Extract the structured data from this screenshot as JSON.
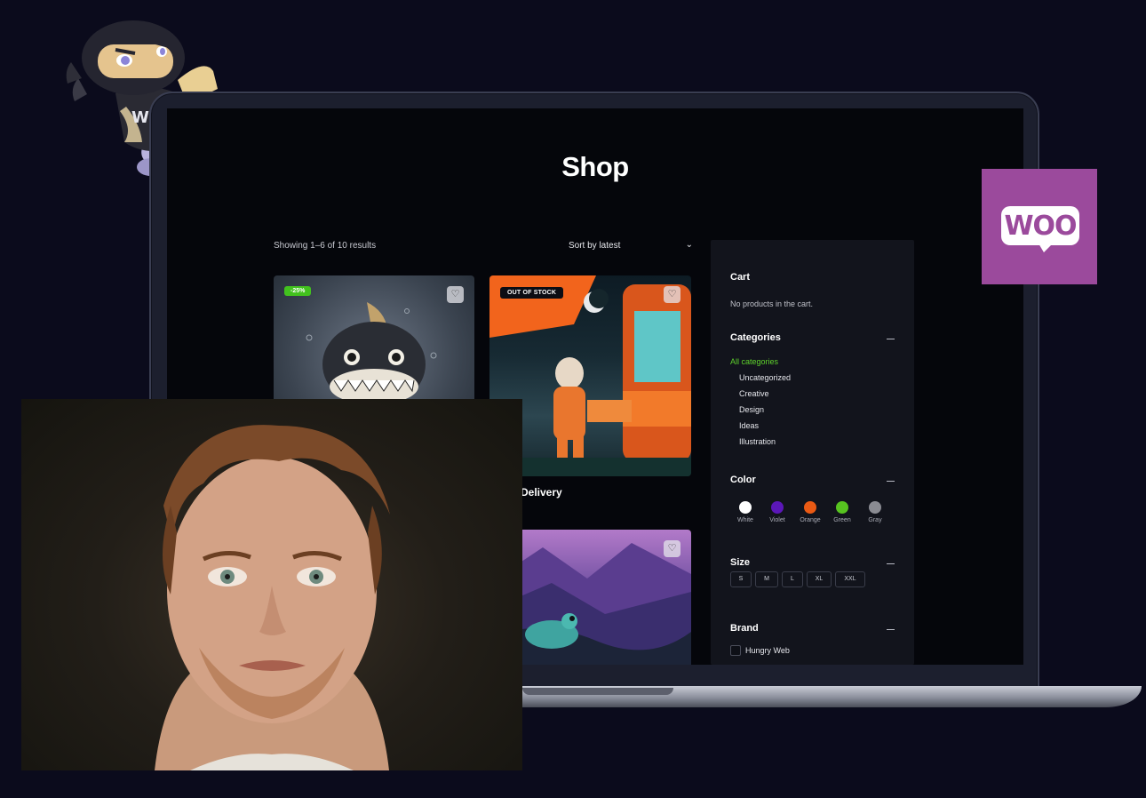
{
  "shop": {
    "title": "Shop",
    "results_text": "Showing 1–6 of 10 results",
    "sort_label": "Sort by latest"
  },
  "products": [
    {
      "badge": "-25%",
      "badge_color": "#42c21e",
      "image": "shark-cartoon-image"
    },
    {
      "badge": "OUT OF STOCK",
      "image": "astronaut-food-cart-image",
      "name_partial": "Delivery"
    },
    {
      "image": "frog-mountains-image"
    }
  ],
  "sidebar": {
    "cart": {
      "title": "Cart",
      "empty_text": "No products in the cart."
    },
    "categories": {
      "title": "Categories",
      "items": [
        "All categories",
        "Uncategorized",
        "Creative",
        "Design",
        "Ideas",
        "Illustration"
      ],
      "active_color": "#5fd32c"
    },
    "color": {
      "title": "Color",
      "items": [
        {
          "label": "White",
          "hex": "#ffffff"
        },
        {
          "label": "Violet",
          "hex": "#5b17b8"
        },
        {
          "label": "Orange",
          "hex": "#ea5a14"
        },
        {
          "label": "Green",
          "hex": "#57c320"
        },
        {
          "label": "Gray",
          "hex": "#8a8b92"
        }
      ]
    },
    "size": {
      "title": "Size",
      "items": [
        "S",
        "M",
        "L",
        "XL",
        "XXL"
      ]
    },
    "brand": {
      "title": "Brand",
      "items": [
        "Hungry Web"
      ]
    }
  },
  "logos": {
    "woo_text": "WOO",
    "woo_color": "#9b4a9c"
  }
}
